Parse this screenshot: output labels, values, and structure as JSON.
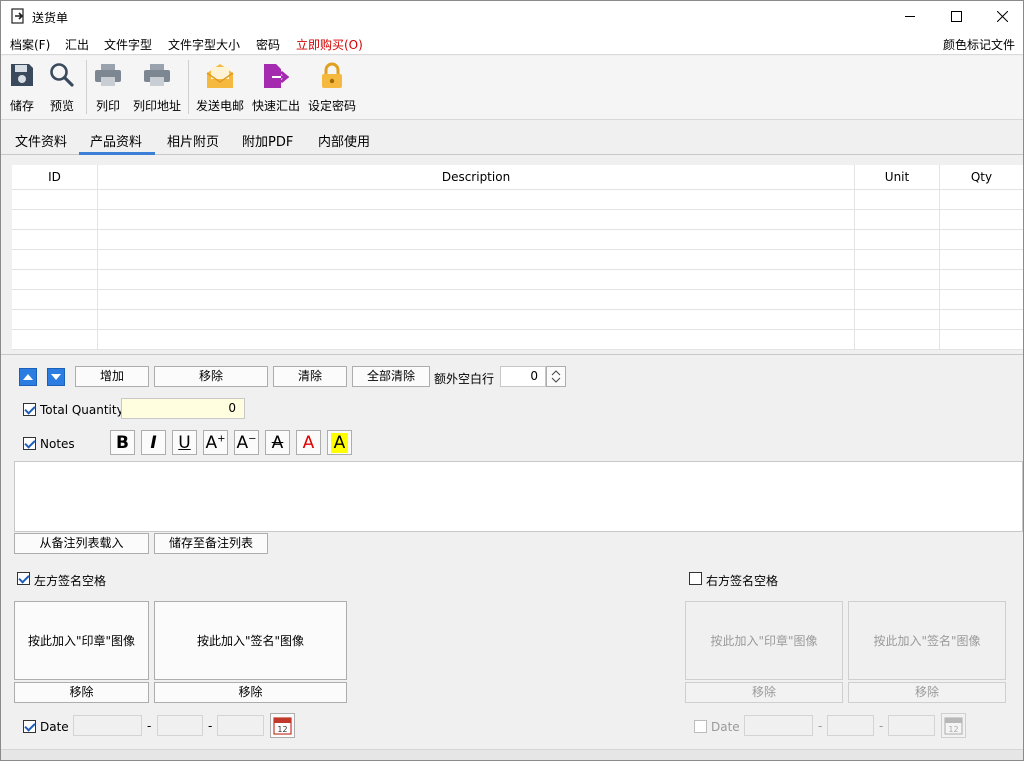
{
  "window": {
    "title": "送货单"
  },
  "menu": {
    "items": [
      "档案(F)",
      "汇出",
      "文件字型",
      "文件字型大小",
      "密码"
    ],
    "buy": "立即购买(O)",
    "right": "颜色标记文件"
  },
  "toolbar": {
    "save": "储存",
    "preview": "预览",
    "print": "列印",
    "print_address": "列印地址",
    "send_email": "发送电邮",
    "quick_export": "快速汇出",
    "set_password": "设定密码"
  },
  "tabs": [
    "文件资料",
    "产品资料",
    "相片附页",
    "附加PDF",
    "内部使用"
  ],
  "table": {
    "columns": [
      "ID",
      "Description",
      "Unit",
      "Qty"
    ]
  },
  "row_controls": {
    "add": "增加",
    "remove": "移除",
    "clear": "清除",
    "clear_all": "全部清除",
    "extra_blank_rows_label": "额外空白行",
    "extra_blank_rows_value": "0"
  },
  "total_quantity": {
    "label": "Total Quantity",
    "value": "0"
  },
  "notes": {
    "label": "Notes",
    "load_button": "从备注列表载入",
    "save_button": "储存至备注列表"
  },
  "left_signature": {
    "label": "左方签名空格",
    "stamp_button": "按此加入\"印章\"图像",
    "signature_button": "按此加入\"签名\"图像",
    "remove": "移除",
    "date_label": "Date"
  },
  "right_signature": {
    "label": "右方签名空格",
    "stamp_button": "按此加入\"印章\"图像",
    "signature_button": "按此加入\"签名\"图像",
    "remove": "移除",
    "date_label": "Date"
  },
  "date_separator": "-",
  "calendar_day": "12",
  "colors": {
    "accent": "#3c7fd6",
    "buy": "#d40000",
    "highlight_field": "#ffffe0"
  }
}
